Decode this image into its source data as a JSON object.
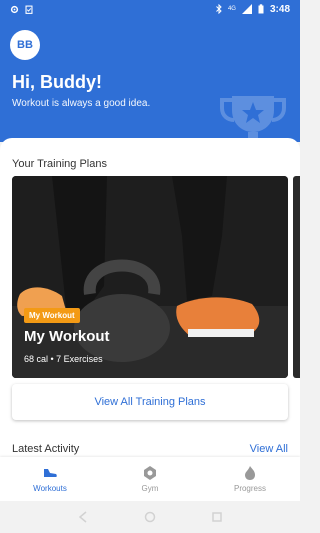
{
  "status_bar": {
    "time": "3:48",
    "signal_label": "4G"
  },
  "header": {
    "avatar_initials": "BB",
    "greeting": "Hi, Buddy!",
    "subtitle": "Workout is always a good idea.",
    "background_color": "#2f6fd6"
  },
  "training_plans": {
    "section_title": "Your Training Plans",
    "cards": [
      {
        "tag": "My Workout",
        "name": "My Workout",
        "meta": "68 cal • 7 Exercises"
      }
    ],
    "view_all_label": "View All Training Plans"
  },
  "latest_activity": {
    "title": "Latest Activity",
    "view_all_label": "View All"
  },
  "bottom_nav": {
    "items": [
      {
        "label": "Workouts",
        "icon": "shoe-icon",
        "active": true
      },
      {
        "label": "Gym",
        "icon": "location-icon",
        "active": false
      },
      {
        "label": "Progress",
        "icon": "flame-icon",
        "active": false
      }
    ]
  },
  "colors": {
    "primary": "#2f6fd6",
    "accent": "#f39a15"
  }
}
